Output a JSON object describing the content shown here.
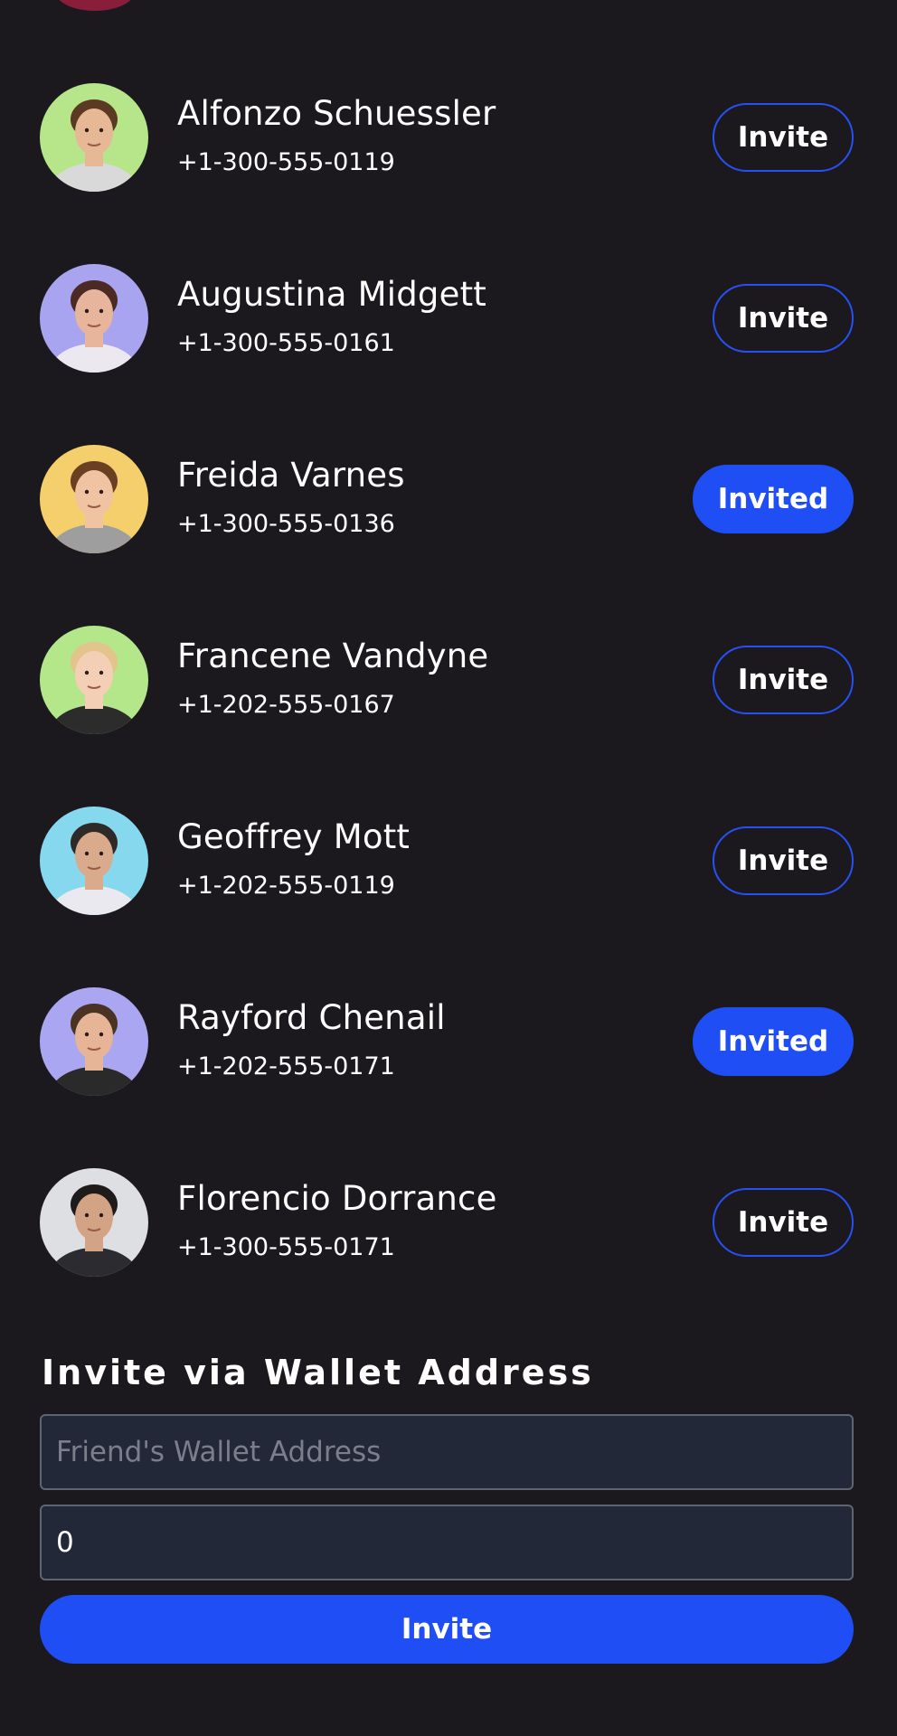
{
  "contacts": [
    {
      "name": "Alfonzo Schuessler",
      "phone": "+1-300-555-0119",
      "button": "Invite",
      "invited": false,
      "avatar_bg": "#b7e68a",
      "skin": "#e6b896",
      "hair": "#5a3a22",
      "shirt": "#d9d9d9"
    },
    {
      "name": "Augustina Midgett",
      "phone": "+1-300-555-0161",
      "button": "Invite",
      "invited": false,
      "avatar_bg": "#a8a4f0",
      "skin": "#e7b59c",
      "hair": "#4a2a22",
      "shirt": "#ece8f0"
    },
    {
      "name": "Freida Varnes",
      "phone": "+1-300-555-0136",
      "button": "Invited",
      "invited": true,
      "avatar_bg": "#f4cf6c",
      "skin": "#f0c4a2",
      "hair": "#6b3f22",
      "shirt": "#9e9e9e"
    },
    {
      "name": "Francene Vandyne",
      "phone": "+1-202-555-0167",
      "button": "Invite",
      "invited": false,
      "avatar_bg": "#b4e68a",
      "skin": "#f3d0b5",
      "hair": "#e2c48c",
      "shirt": "#2c2c2c"
    },
    {
      "name": "Geoffrey Mott",
      "phone": "+1-202-555-0119",
      "button": "Invite",
      "invited": false,
      "avatar_bg": "#86d8ee",
      "skin": "#d9ab8c",
      "hair": "#2e2a28",
      "shirt": "#e9e9ef"
    },
    {
      "name": "Rayford Chenail",
      "phone": "+1-202-555-0171",
      "button": "Invited",
      "invited": true,
      "avatar_bg": "#aaa6f2",
      "skin": "#e6b496",
      "hair": "#4a3322",
      "shirt": "#2a2a2a"
    },
    {
      "name": "Florencio Dorrance",
      "phone": "+1-300-555-0171",
      "button": "Invite",
      "invited": false,
      "avatar_bg": "#dedfe3",
      "skin": "#d2a384",
      "hair": "#1f1b1a",
      "shirt": "#2b2b30"
    }
  ],
  "wallet": {
    "heading": "Invite via Wallet Address",
    "address_placeholder": "Friend's Wallet Address",
    "amount_value": "0",
    "submit_label": "Invite"
  },
  "colors": {
    "background": "#1b191e",
    "accent": "#1f4ef5",
    "field_bg": "#222838"
  }
}
